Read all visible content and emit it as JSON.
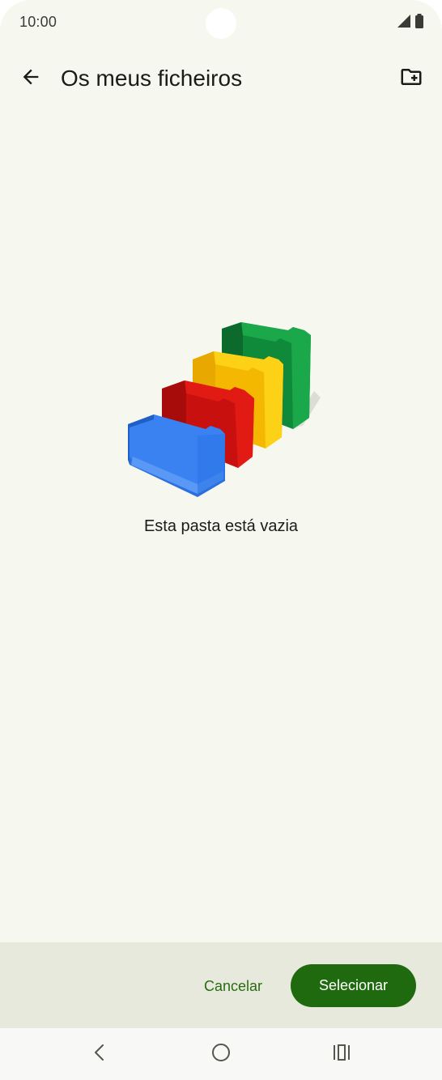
{
  "status_bar": {
    "time": "10:00",
    "icons": [
      "signal-icon",
      "battery-icon"
    ]
  },
  "app_bar": {
    "back_icon": "arrow-back-icon",
    "title": "Os meus ficheiros",
    "action_icon": "create-new-folder-icon"
  },
  "empty_state": {
    "illustration": "empty-folders-illustration",
    "message": "Esta pasta está vazia"
  },
  "actions": {
    "cancel_label": "Cancelar",
    "select_label": "Selecionar"
  },
  "nav_bar": {
    "icons": [
      "nav-back-icon",
      "nav-home-icon",
      "nav-recents-icon"
    ]
  },
  "colors": {
    "background": "#f6f7ee",
    "action_bar": "#e6e9dc",
    "primary": "#1f6a0f",
    "cancel_text": "#2a6b12"
  }
}
